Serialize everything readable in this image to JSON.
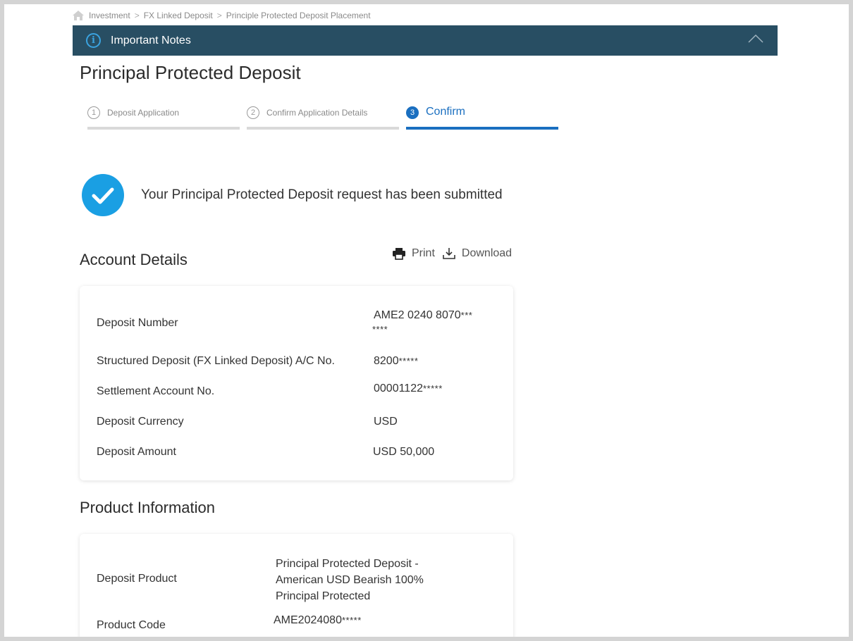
{
  "breadcrumb": {
    "items": [
      "Investment",
      "FX Linked Deposit",
      "Principle Protected Deposit Placement"
    ],
    "separator": ">"
  },
  "notes": {
    "title": "Important Notes",
    "icon": "info-icon",
    "toggle_icon": "chevron-up-icon"
  },
  "page": {
    "title": "Principal Protected Deposit"
  },
  "stepper": {
    "steps": [
      {
        "number": "1",
        "label": "Deposit Application",
        "state": "done"
      },
      {
        "number": "2",
        "label": "Confirm Application Details",
        "state": "done"
      },
      {
        "number": "3",
        "label": "Confirm",
        "state": "active"
      }
    ]
  },
  "success": {
    "message": "Your Principal Protected Deposit request has been submitted"
  },
  "account_details": {
    "title": "Account Details",
    "print_label": "Print",
    "download_label": "Download",
    "rows": [
      {
        "label": "Deposit Number",
        "value": "AME2 0240 8070",
        "mask": "***",
        "mask2": "****"
      },
      {
        "label": "Structured Deposit (FX Linked Deposit) A/C No.",
        "value": "8200",
        "mask": "*****"
      },
      {
        "label": "Settlement Account No.",
        "value": "00001122",
        "mask": "*****"
      },
      {
        "label": "Deposit Currency",
        "value": "USD"
      },
      {
        "label": "Deposit Amount",
        "value": "USD 50,000"
      }
    ]
  },
  "product_info": {
    "title": "Product Information",
    "rows": [
      {
        "label": "Deposit Product",
        "value_lines": [
          "Principal Protected Deposit -",
          "American USD Bearish 100%",
          "Principal Protected"
        ]
      },
      {
        "label": "Product Code",
        "value": "AME2024080",
        "mask": "*****"
      }
    ]
  },
  "colors": {
    "notes_bar": "#284e63",
    "accent": "#1a6fc0",
    "success": "#1a9fe3"
  }
}
